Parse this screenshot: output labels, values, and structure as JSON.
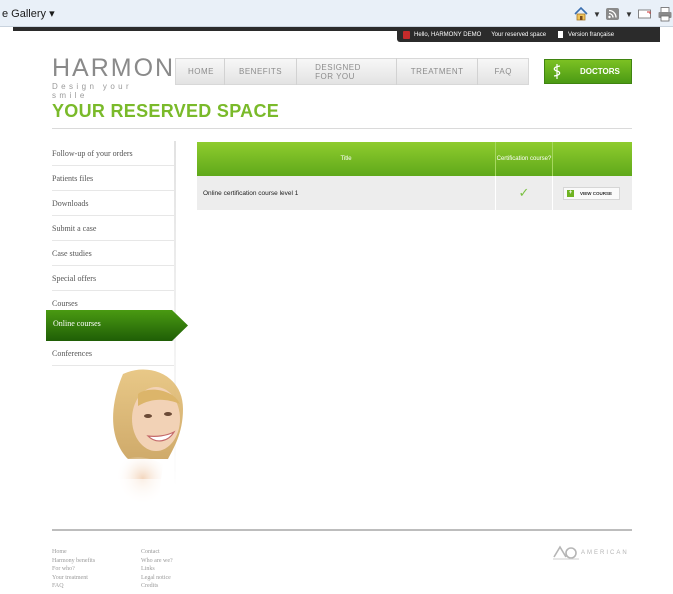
{
  "browser": {
    "gallery_label": "e Gallery ▾",
    "icons": [
      "home-icon",
      "rss-feed-icon",
      "mail-icon",
      "print-icon"
    ]
  },
  "topbar": {
    "greeting": "Hello, HARMONY DEMO",
    "reserved_link": "Your reserved space",
    "language_link": "Version française"
  },
  "logo": {
    "brand": "HARMONY",
    "tagline": "Design your smile"
  },
  "nav": {
    "items": [
      "HOME",
      "BENEFITS",
      "DESIGNED FOR YOU",
      "TREATMENT",
      "FAQ"
    ],
    "doctors": "DOCTORS"
  },
  "page": {
    "title": "YOUR RESERVED SPACE"
  },
  "sidebar": {
    "items": [
      "Follow-up of your orders",
      "Patients files",
      "Downloads",
      "Submit a case",
      "Case studies",
      "Special offers",
      "Courses",
      "Online courses",
      "Conferences"
    ],
    "active_index": 7
  },
  "table": {
    "headers": [
      "Title",
      "Certification course?",
      ""
    ],
    "rows": [
      {
        "title": "Online certification course level 1",
        "certified": "✓",
        "action": "VIEW COURSE"
      }
    ]
  },
  "footer": {
    "col1": [
      "Home",
      "Harmony benefits",
      "For who?",
      "Your treatment",
      "FAQ"
    ],
    "col2": [
      "Contact",
      "Who are we?",
      "Links",
      "Legal notice",
      "Credits"
    ],
    "partner_logo": "AMERICAN"
  },
  "colors": {
    "accent": "#7aba2a",
    "header_green": "#6fb322",
    "active_green": "#2f7a0c",
    "dark": "#2b2b2b"
  }
}
